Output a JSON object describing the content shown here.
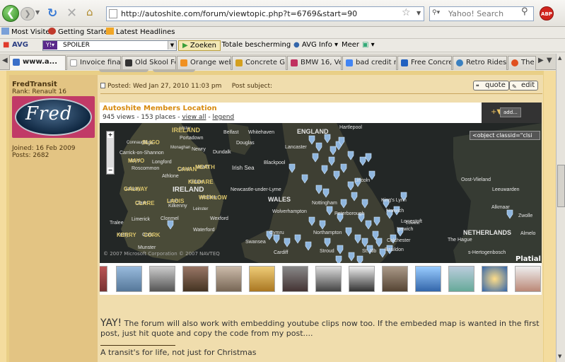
{
  "browser": {
    "url": "http://autoshite.com/forum/viewtopic.php?t=6769&start=90",
    "search_placeholder": "Yahoo! Search",
    "adblock": "ABP"
  },
  "bookmarks": [
    "Most Visited",
    "Getting Started",
    "Latest Headlines"
  ],
  "toolbar": {
    "avg": "AVG",
    "search_value": "SPOILER",
    "zoeken": "Zoeken",
    "protection": "Totale bescherming",
    "avginfo": "AVG Info",
    "meer": "Meer"
  },
  "tabs": [
    {
      "label": "www.a...",
      "color": "#3a6fc8"
    },
    {
      "label": "Invoice fina...",
      "color": "#ffffff"
    },
    {
      "label": "Old Skool Fo...",
      "color": "#333333"
    },
    {
      "label": "Orange web...",
      "color": "#f09020"
    },
    {
      "label": "Concrete G...",
      "color": "#d4a020"
    },
    {
      "label": "BMW 16, Ve...",
      "color": "#c03060"
    },
    {
      "label": "bad credit m...",
      "color": "#4285f4"
    },
    {
      "label": "Free Concre...",
      "color": "#2060c0"
    },
    {
      "label": "Retro Rides ...",
      "color": "#3a80c0"
    },
    {
      "label": "The",
      "color": "#e05020"
    }
  ],
  "post": {
    "username": "FredTransit",
    "rank": "Rank: Renault 16",
    "avatar_text": "Fred",
    "joined": "Joined: 16 Feb 2009",
    "posts": "Posts: 2682",
    "posted": "Posted: Wed Jan 27, 2010 11:03 pm     Post subject:",
    "quote": "quote",
    "edit": "edit",
    "body_yay": "YAY!",
    "body_text": " The forum will also work with embedding youtube clips now too. If the embeded map is wanted in the first post, just hit quote and copy the code from my post....",
    "signature": "A transit's for life, not just for Christmas"
  },
  "map": {
    "title": "Autoshite Members Location",
    "views": "945 views - 153 places - ",
    "view_all": "view all",
    "sep": " - ",
    "legend": "legend",
    "add": "add...",
    "object_tag": "<object classid=\"clsi",
    "copyright": "© 2007 Microsoft Corporation  © 2007 NAVTEQ",
    "platial": "Platial",
    "labels_white": [
      "IRELAND",
      "ENGLAND",
      "WALES",
      "NETHERLANDS",
      "Hartlepool",
      "Belfast",
      "Whitehaven",
      "Portadown",
      "Newry",
      "Douglas",
      "Lancaster",
      "Dundalk",
      "Blackpool",
      "Newcastle-under-Lyme",
      "Nottingham",
      "Lincoln",
      "Wolverhampton",
      "Peterborough",
      "Norwich",
      "King's Lynn",
      "Lowestoft",
      "Ipswich",
      "Colchester",
      "Northampton",
      "Cardiff",
      "Swansea",
      "Stroud",
      "St. Alb",
      "Basildon",
      "Oost-Vlieland",
      "Leeuwarden",
      "Alkmaar",
      "Zwolle",
      "Almelo",
      "The Hague",
      "s-Hertogenbosch",
      "Galway",
      "Limerick",
      "Tralee",
      "Cork",
      "Waterford",
      "Wexford",
      "Kilkenny",
      "Clonmel",
      "Athlone",
      "Roscommon",
      "Longford",
      "Carrick-on-Shannon",
      "Sligo",
      "Cavan",
      "Mayo",
      "Meath",
      "Kildare",
      "Wicklow",
      "Laois",
      "Clare",
      "Kerry",
      "Munster",
      "Irish Sea",
      "Connaught",
      "Ulster",
      "Leinster",
      "Monaghan",
      "Cymru",
      "Lowest"
    ],
    "labels_yellow": [
      "IRELAND",
      "SLIGO",
      "CAVAN",
      "MAYO",
      "MEATH",
      "KILDARE",
      "GALWAY",
      "WICKLOW",
      "CLARE",
      "KERRY",
      "CORK",
      "LAOIS"
    ]
  }
}
